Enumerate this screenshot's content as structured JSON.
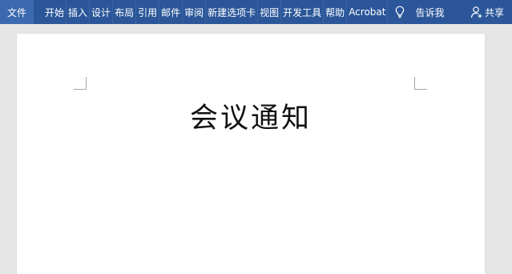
{
  "ribbon": {
    "background_color": "#2b579a",
    "tabs": [
      {
        "label": "文件"
      },
      {
        "label": "开始"
      },
      {
        "label": "插入"
      },
      {
        "label": "设计"
      },
      {
        "label": "布局"
      },
      {
        "label": "引用"
      },
      {
        "label": "邮件"
      },
      {
        "label": "审阅"
      },
      {
        "label": "新建选项卡"
      },
      {
        "label": "视图"
      },
      {
        "label": "开发工具"
      },
      {
        "label": "帮助"
      },
      {
        "label": "Acrobat"
      }
    ],
    "tell_me": {
      "label": "告诉我",
      "icon": "lightbulb-icon"
    },
    "share": {
      "label": "共享",
      "icon": "person-add-icon"
    }
  },
  "document": {
    "title": "会议通知"
  }
}
